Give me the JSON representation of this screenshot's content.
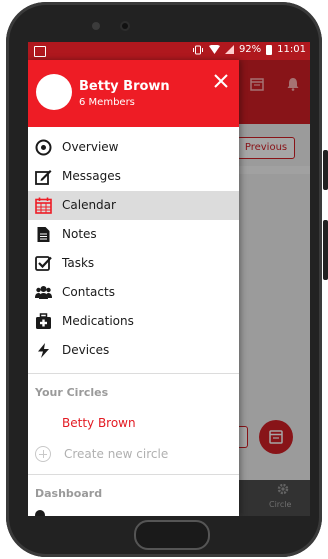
{
  "status_bar": {
    "battery": "92%",
    "time": "11:01"
  },
  "background": {
    "previous_label": "Previous",
    "bottom_nav_label": "Circle"
  },
  "drawer": {
    "header": {
      "name": "Betty Brown",
      "members": "6 Members"
    },
    "menu": [
      {
        "label": "Overview",
        "icon": "overview-icon"
      },
      {
        "label": "Messages",
        "icon": "messages-icon"
      },
      {
        "label": "Calendar",
        "icon": "calendar-icon",
        "active": true
      },
      {
        "label": "Notes",
        "icon": "notes-icon"
      },
      {
        "label": "Tasks",
        "icon": "tasks-icon"
      },
      {
        "label": "Contacts",
        "icon": "contacts-icon"
      },
      {
        "label": "Medications",
        "icon": "medications-icon"
      },
      {
        "label": "Devices",
        "icon": "devices-icon"
      }
    ],
    "your_circles_title": "Your Circles",
    "circles": [
      "Betty Brown"
    ],
    "create_circle_label": "Create new circle",
    "dashboard_title": "Dashboard"
  },
  "colors": {
    "brand_red": "#ee1c25",
    "active_bg": "#dcdcdc"
  }
}
